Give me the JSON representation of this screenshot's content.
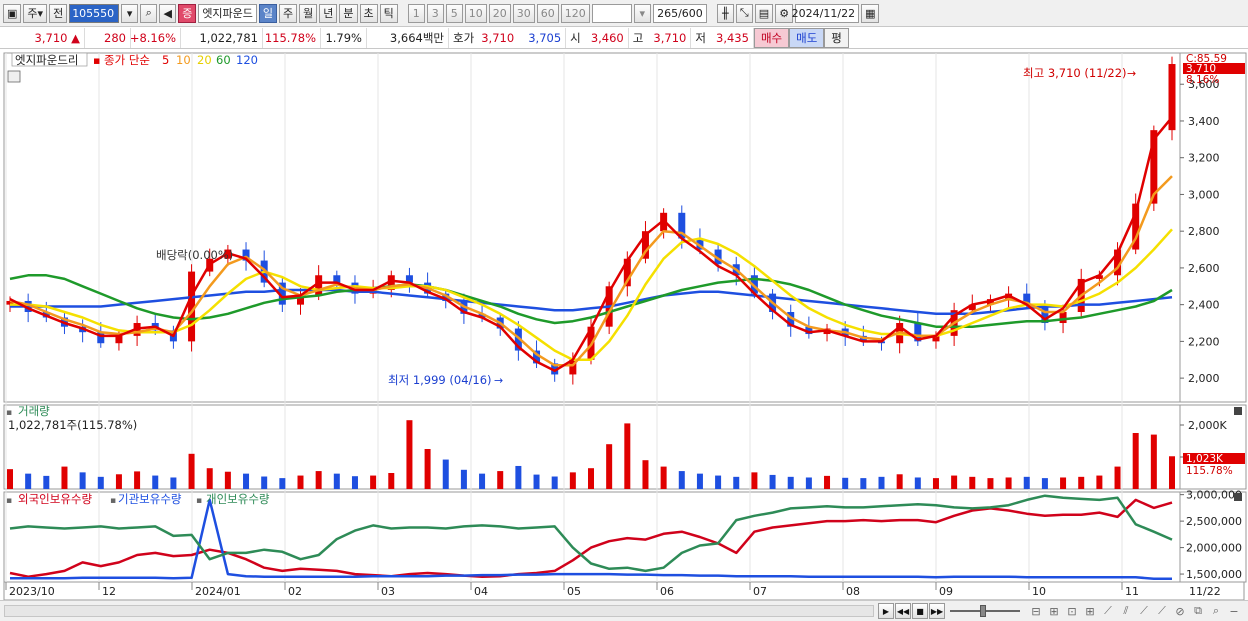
{
  "toolbar": {
    "market": "주",
    "period_prefix": "전",
    "code": "105550",
    "stock_name": "엣지파운드",
    "stock_badge": "증",
    "periods": [
      "일",
      "주",
      "월",
      "년",
      "분",
      "초",
      "틱"
    ],
    "active_period": "일",
    "intervals": [
      "1",
      "3",
      "5",
      "10",
      "20",
      "30",
      "60",
      "120"
    ],
    "count": "265",
    "count_total": "/600",
    "date": "2024/11/22"
  },
  "quote": {
    "price": "3,710",
    "change": "280",
    "change_pct": "+8.16%",
    "volume": "1,022,781",
    "volume_ratio": "115.78%",
    "turnover": "1.79%",
    "amount": "3,664백만",
    "bid_label": "호가",
    "bid1": "3,710",
    "bid2": "3,705",
    "open_label": "시",
    "open": "3,460",
    "high_label": "고",
    "high": "3,710",
    "low_label": "저",
    "low": "3,435",
    "buy_label": "매수",
    "sell_label": "매도",
    "eval_label": "평"
  },
  "legend": {
    "name": "엣지파운드리",
    "ma_label": "종가 단순",
    "ma_periods": [
      "5",
      "10",
      "20",
      "60",
      "120"
    ],
    "volume_title": "거래량",
    "volume_value": "1,022,781주(115.78%)",
    "holdings": [
      "외국인보유수량",
      "기관보유수량",
      "개인보유수량"
    ]
  },
  "annotations": {
    "dividend": "배당락(0.00%)",
    "high": "최고 3,710 (11/22)",
    "low": "최저 1,999 (04/16)",
    "right_top": "C:85.59",
    "price_badge": "3,710",
    "pct_badge": "8.16%",
    "vol_badge": "1,023K",
    "vol_pct_badge": "115.78%"
  },
  "colors": {
    "ma5": "#e00000",
    "ma10": "#f39a1e",
    "ma20": "#f5e000",
    "ma60": "#1e9a2a",
    "ma120": "#1e4fe0",
    "up": "#e00000",
    "down": "#1e4fe0",
    "foreign": "#d0021b",
    "institution": "#1e4fe0",
    "individual": "#2e8b57"
  },
  "chart_data": [
    {
      "type": "line",
      "title": "엣지파운드리",
      "x_axis_labels": [
        "2023/10",
        "12",
        "2024/01",
        "02",
        "03",
        "04",
        "05",
        "06",
        "07",
        "08",
        "09",
        "10",
        "11",
        "11/22"
      ],
      "y_ticks": [
        2000,
        2200,
        2400,
        2600,
        2800,
        3000,
        3200,
        3400,
        3600
      ],
      "ylim": [
        1870,
        3770
      ],
      "close": [
        2420,
        2360,
        2330,
        2280,
        2250,
        2190,
        2230,
        2300,
        2260,
        2200,
        2580,
        2650,
        2700,
        2640,
        2520,
        2400,
        2450,
        2560,
        2520,
        2460,
        2480,
        2560,
        2520,
        2460,
        2420,
        2350,
        2330,
        2270,
        2150,
        2080,
        2020,
        2100,
        2280,
        2500,
        2650,
        2800,
        2900,
        2760,
        2700,
        2620,
        2560,
        2460,
        2360,
        2280,
        2240,
        2270,
        2230,
        2200,
        2190,
        2300,
        2200,
        2230,
        2370,
        2400,
        2430,
        2460,
        2400,
        2300,
        2360,
        2540,
        2560,
        2700,
        2950,
        3350,
        3710
      ],
      "ma5": [
        2430,
        2380,
        2340,
        2300,
        2270,
        2230,
        2230,
        2270,
        2280,
        2230,
        2450,
        2620,
        2680,
        2650,
        2550,
        2440,
        2450,
        2520,
        2520,
        2480,
        2480,
        2530,
        2520,
        2470,
        2430,
        2360,
        2330,
        2280,
        2170,
        2090,
        2040,
        2100,
        2270,
        2470,
        2640,
        2780,
        2860,
        2760,
        2690,
        2610,
        2560,
        2460,
        2370,
        2290,
        2250,
        2260,
        2230,
        2200,
        2200,
        2280,
        2210,
        2230,
        2340,
        2400,
        2420,
        2450,
        2400,
        2320,
        2380,
        2520,
        2560,
        2680,
        2900,
        3300,
        3420
      ],
      "ma10": [
        2420,
        2400,
        2360,
        2320,
        2290,
        2250,
        2240,
        2250,
        2270,
        2250,
        2360,
        2500,
        2620,
        2660,
        2590,
        2490,
        2450,
        2480,
        2510,
        2490,
        2480,
        2500,
        2510,
        2490,
        2450,
        2390,
        2350,
        2300,
        2220,
        2130,
        2070,
        2070,
        2180,
        2360,
        2530,
        2690,
        2800,
        2790,
        2720,
        2650,
        2590,
        2500,
        2410,
        2330,
        2280,
        2260,
        2250,
        2220,
        2210,
        2250,
        2230,
        2230,
        2300,
        2360,
        2400,
        2430,
        2410,
        2360,
        2360,
        2450,
        2520,
        2600,
        2760,
        3000,
        3100
      ],
      "ma20": [
        2400,
        2400,
        2390,
        2360,
        2330,
        2290,
        2260,
        2250,
        2250,
        2250,
        2290,
        2370,
        2460,
        2540,
        2580,
        2550,
        2500,
        2480,
        2490,
        2500,
        2490,
        2490,
        2500,
        2500,
        2480,
        2440,
        2400,
        2350,
        2290,
        2220,
        2150,
        2100,
        2100,
        2200,
        2340,
        2510,
        2650,
        2740,
        2760,
        2730,
        2680,
        2610,
        2530,
        2450,
        2380,
        2330,
        2290,
        2260,
        2240,
        2240,
        2230,
        2230,
        2260,
        2300,
        2340,
        2380,
        2400,
        2400,
        2390,
        2420,
        2460,
        2520,
        2600,
        2700,
        2810
      ],
      "ma60": [
        2540,
        2560,
        2560,
        2540,
        2500,
        2460,
        2420,
        2380,
        2350,
        2330,
        2320,
        2330,
        2350,
        2380,
        2410,
        2430,
        2440,
        2450,
        2470,
        2480,
        2490,
        2500,
        2510,
        2500,
        2480,
        2450,
        2420,
        2390,
        2350,
        2320,
        2300,
        2310,
        2330,
        2360,
        2390,
        2420,
        2450,
        2480,
        2500,
        2520,
        2530,
        2540,
        2530,
        2510,
        2480,
        2440,
        2400,
        2370,
        2340,
        2320,
        2300,
        2280,
        2280,
        2280,
        2290,
        2300,
        2310,
        2310,
        2320,
        2330,
        2350,
        2370,
        2390,
        2420,
        2480
      ],
      "ma120": [
        2390,
        2390,
        2390,
        2390,
        2390,
        2390,
        2400,
        2410,
        2420,
        2430,
        2440,
        2450,
        2460,
        2470,
        2470,
        2480,
        2480,
        2480,
        2480,
        2470,
        2470,
        2460,
        2450,
        2440,
        2430,
        2420,
        2410,
        2400,
        2390,
        2380,
        2370,
        2370,
        2380,
        2390,
        2410,
        2430,
        2450,
        2460,
        2470,
        2470,
        2460,
        2450,
        2440,
        2430,
        2420,
        2410,
        2400,
        2390,
        2380,
        2370,
        2360,
        2350,
        2350,
        2350,
        2360,
        2370,
        2380,
        2390,
        2390,
        2400,
        2400,
        2410,
        2420,
        2430,
        2440
      ]
    },
    {
      "type": "bar",
      "title": "거래량",
      "y_ticks": [
        1000000,
        2000000
      ],
      "tick_labels": [
        "1,000K",
        "2,000K"
      ],
      "ylim": [
        0,
        2500000
      ],
      "volume": [
        620,
        480,
        410,
        700,
        520,
        380,
        460,
        550,
        420,
        360,
        1100,
        650,
        540,
        480,
        390,
        340,
        420,
        560,
        480,
        400,
        420,
        500,
        2150,
        1250,
        920,
        600,
        480,
        560,
        720,
        450,
        390,
        520,
        650,
        1400,
        2050,
        900,
        700,
        560,
        480,
        420,
        380,
        520,
        440,
        380,
        360,
        410,
        350,
        340,
        380,
        460,
        360,
        340,
        420,
        380,
        340,
        360,
        380,
        340,
        360,
        380,
        420,
        700,
        1750,
        1700,
        1023
      ],
      "up": [
        1,
        0,
        0,
        1,
        0,
        0,
        1,
        1,
        0,
        0,
        1,
        1,
        1,
        0,
        0,
        0,
        1,
        1,
        0,
        0,
        1,
        1,
        1,
        1,
        0,
        0,
        0,
        1,
        0,
        0,
        0,
        1,
        1,
        1,
        1,
        1,
        1,
        0,
        0,
        0,
        0,
        1,
        0,
        0,
        0,
        1,
        0,
        0,
        0,
        1,
        0,
        1,
        1,
        1,
        1,
        1,
        0,
        0,
        1,
        1,
        1,
        1,
        1,
        1,
        1
      ]
    },
    {
      "type": "line",
      "title": "외국인보유수량 / 기관보유수량 / 개인보유수량",
      "y_ticks": [
        1500000,
        2000000,
        2500000,
        3000000
      ],
      "tick_labels": [
        "1,500,000",
        "2,000,000",
        "2,500,000",
        "3,000,000"
      ],
      "ylim": [
        1350000,
        3050000
      ],
      "series": [
        {
          "name": "외국인보유수량",
          "values": [
            1520,
            1450,
            1500,
            1560,
            1720,
            1650,
            1720,
            1860,
            1900,
            1840,
            1860,
            1960,
            1900,
            1780,
            1620,
            1560,
            1600,
            1580,
            1560,
            1500,
            1480,
            1460,
            1500,
            1520,
            1500,
            1470,
            1450,
            1460,
            1500,
            1520,
            1560,
            1760,
            2000,
            2120,
            2180,
            2150,
            2260,
            2300,
            2200,
            2080,
            1900,
            2300,
            2380,
            2420,
            2460,
            2500,
            2500,
            2520,
            2500,
            2520,
            2520,
            2480,
            2600,
            2700,
            2740,
            2700,
            2640,
            2600,
            2620,
            2620,
            2660,
            2580,
            2900,
            2750,
            2850
          ]
        },
        {
          "name": "기관보유수량",
          "values": [
            1420,
            1420,
            1420,
            1420,
            1430,
            1430,
            1430,
            1430,
            1430,
            1420,
            1430,
            2900,
            1500,
            1460,
            1450,
            1450,
            1450,
            1450,
            1450,
            1450,
            1460,
            1460,
            1460,
            1460,
            1470,
            1470,
            1480,
            1480,
            1490,
            1490,
            1500,
            1500,
            1500,
            1500,
            1490,
            1490,
            1480,
            1480,
            1470,
            1470,
            1460,
            1460,
            1460,
            1460,
            1450,
            1450,
            1450,
            1450,
            1450,
            1450,
            1450,
            1440,
            1450,
            1450,
            1450,
            1450,
            1440,
            1440,
            1440,
            1440,
            1440,
            1440,
            1440,
            1410,
            1410
          ]
        },
        {
          "name": "개인보유수량",
          "values": [
            2360,
            2400,
            2380,
            2360,
            2380,
            2400,
            2360,
            2380,
            2400,
            2220,
            2240,
            1780,
            1900,
            1900,
            1960,
            1920,
            1780,
            1860,
            2160,
            2320,
            2420,
            2360,
            2380,
            2380,
            2360,
            2400,
            2420,
            2400,
            2360,
            2380,
            2400,
            2000,
            1700,
            1600,
            1620,
            1560,
            1620,
            1900,
            2040,
            2080,
            2520,
            2600,
            2660,
            2740,
            2760,
            2780,
            2760,
            2760,
            2780,
            2800,
            2820,
            2800,
            2760,
            2740,
            2760,
            2800,
            2900,
            2980,
            2940,
            2920,
            2900,
            2940,
            2440,
            2300,
            2150
          ]
        }
      ]
    }
  ]
}
